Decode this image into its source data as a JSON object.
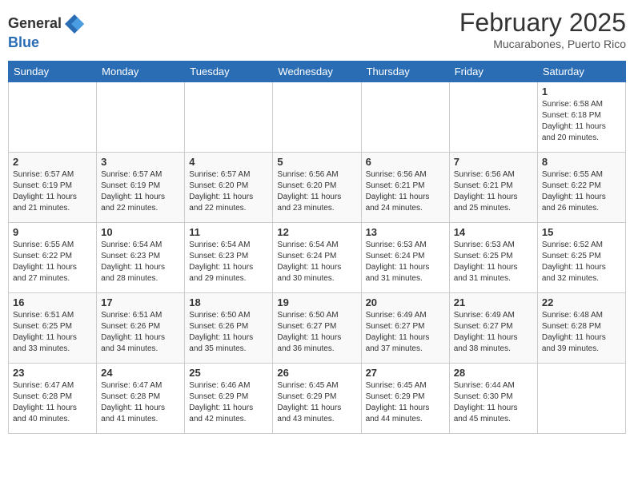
{
  "header": {
    "logo_line1": "General",
    "logo_line2": "Blue",
    "title": "February 2025",
    "subtitle": "Mucarabones, Puerto Rico"
  },
  "days_of_week": [
    "Sunday",
    "Monday",
    "Tuesday",
    "Wednesday",
    "Thursday",
    "Friday",
    "Saturday"
  ],
  "weeks": [
    [
      {
        "day": "",
        "info": ""
      },
      {
        "day": "",
        "info": ""
      },
      {
        "day": "",
        "info": ""
      },
      {
        "day": "",
        "info": ""
      },
      {
        "day": "",
        "info": ""
      },
      {
        "day": "",
        "info": ""
      },
      {
        "day": "1",
        "info": "Sunrise: 6:58 AM\nSunset: 6:18 PM\nDaylight: 11 hours\nand 20 minutes."
      }
    ],
    [
      {
        "day": "2",
        "info": "Sunrise: 6:57 AM\nSunset: 6:19 PM\nDaylight: 11 hours\nand 21 minutes."
      },
      {
        "day": "3",
        "info": "Sunrise: 6:57 AM\nSunset: 6:19 PM\nDaylight: 11 hours\nand 22 minutes."
      },
      {
        "day": "4",
        "info": "Sunrise: 6:57 AM\nSunset: 6:20 PM\nDaylight: 11 hours\nand 22 minutes."
      },
      {
        "day": "5",
        "info": "Sunrise: 6:56 AM\nSunset: 6:20 PM\nDaylight: 11 hours\nand 23 minutes."
      },
      {
        "day": "6",
        "info": "Sunrise: 6:56 AM\nSunset: 6:21 PM\nDaylight: 11 hours\nand 24 minutes."
      },
      {
        "day": "7",
        "info": "Sunrise: 6:56 AM\nSunset: 6:21 PM\nDaylight: 11 hours\nand 25 minutes."
      },
      {
        "day": "8",
        "info": "Sunrise: 6:55 AM\nSunset: 6:22 PM\nDaylight: 11 hours\nand 26 minutes."
      }
    ],
    [
      {
        "day": "9",
        "info": "Sunrise: 6:55 AM\nSunset: 6:22 PM\nDaylight: 11 hours\nand 27 minutes."
      },
      {
        "day": "10",
        "info": "Sunrise: 6:54 AM\nSunset: 6:23 PM\nDaylight: 11 hours\nand 28 minutes."
      },
      {
        "day": "11",
        "info": "Sunrise: 6:54 AM\nSunset: 6:23 PM\nDaylight: 11 hours\nand 29 minutes."
      },
      {
        "day": "12",
        "info": "Sunrise: 6:54 AM\nSunset: 6:24 PM\nDaylight: 11 hours\nand 30 minutes."
      },
      {
        "day": "13",
        "info": "Sunrise: 6:53 AM\nSunset: 6:24 PM\nDaylight: 11 hours\nand 31 minutes."
      },
      {
        "day": "14",
        "info": "Sunrise: 6:53 AM\nSunset: 6:25 PM\nDaylight: 11 hours\nand 31 minutes."
      },
      {
        "day": "15",
        "info": "Sunrise: 6:52 AM\nSunset: 6:25 PM\nDaylight: 11 hours\nand 32 minutes."
      }
    ],
    [
      {
        "day": "16",
        "info": "Sunrise: 6:51 AM\nSunset: 6:25 PM\nDaylight: 11 hours\nand 33 minutes."
      },
      {
        "day": "17",
        "info": "Sunrise: 6:51 AM\nSunset: 6:26 PM\nDaylight: 11 hours\nand 34 minutes."
      },
      {
        "day": "18",
        "info": "Sunrise: 6:50 AM\nSunset: 6:26 PM\nDaylight: 11 hours\nand 35 minutes."
      },
      {
        "day": "19",
        "info": "Sunrise: 6:50 AM\nSunset: 6:27 PM\nDaylight: 11 hours\nand 36 minutes."
      },
      {
        "day": "20",
        "info": "Sunrise: 6:49 AM\nSunset: 6:27 PM\nDaylight: 11 hours\nand 37 minutes."
      },
      {
        "day": "21",
        "info": "Sunrise: 6:49 AM\nSunset: 6:27 PM\nDaylight: 11 hours\nand 38 minutes."
      },
      {
        "day": "22",
        "info": "Sunrise: 6:48 AM\nSunset: 6:28 PM\nDaylight: 11 hours\nand 39 minutes."
      }
    ],
    [
      {
        "day": "23",
        "info": "Sunrise: 6:47 AM\nSunset: 6:28 PM\nDaylight: 11 hours\nand 40 minutes."
      },
      {
        "day": "24",
        "info": "Sunrise: 6:47 AM\nSunset: 6:28 PM\nDaylight: 11 hours\nand 41 minutes."
      },
      {
        "day": "25",
        "info": "Sunrise: 6:46 AM\nSunset: 6:29 PM\nDaylight: 11 hours\nand 42 minutes."
      },
      {
        "day": "26",
        "info": "Sunrise: 6:45 AM\nSunset: 6:29 PM\nDaylight: 11 hours\nand 43 minutes."
      },
      {
        "day": "27",
        "info": "Sunrise: 6:45 AM\nSunset: 6:29 PM\nDaylight: 11 hours\nand 44 minutes."
      },
      {
        "day": "28",
        "info": "Sunrise: 6:44 AM\nSunset: 6:30 PM\nDaylight: 11 hours\nand 45 minutes."
      },
      {
        "day": "",
        "info": ""
      }
    ]
  ]
}
